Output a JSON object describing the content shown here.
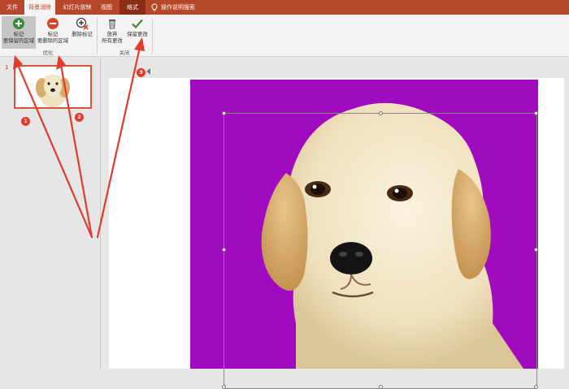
{
  "tabs": [
    {
      "label": "文件",
      "state": "normal"
    },
    {
      "label": "背景消除",
      "state": "active"
    },
    {
      "label": "幻灯片放映",
      "state": "normal"
    },
    {
      "label": "视图",
      "state": "normal"
    },
    {
      "label": "格式",
      "state": "context"
    }
  ],
  "search": {
    "label": "操作说明搜索",
    "icon": "lightbulb-icon"
  },
  "ribbon": {
    "mark_keep": {
      "line1": "标记",
      "line2": "要保留的区域",
      "icon": "plus-circle-icon"
    },
    "mark_remove": {
      "line1": "标记",
      "line2": "要删除的区域",
      "icon": "minus-circle-icon"
    },
    "delete_mark": {
      "label": "删除标记",
      "icon": "eraser-icon"
    },
    "refine_group": "优化",
    "discard": {
      "line1": "放弃",
      "line2": "所有更改",
      "icon": "trash-icon"
    },
    "keep_changes": {
      "label": "保留更改",
      "icon": "checkmark-icon"
    },
    "close_group": "关闭"
  },
  "thumbnail_panel": {
    "slide_number": "1"
  },
  "callouts": [
    "1",
    "2",
    "3"
  ],
  "colors": {
    "brand": "#b7472a",
    "background_removal_magenta": "#a10bc0",
    "callout_red": "#e23b2e"
  }
}
